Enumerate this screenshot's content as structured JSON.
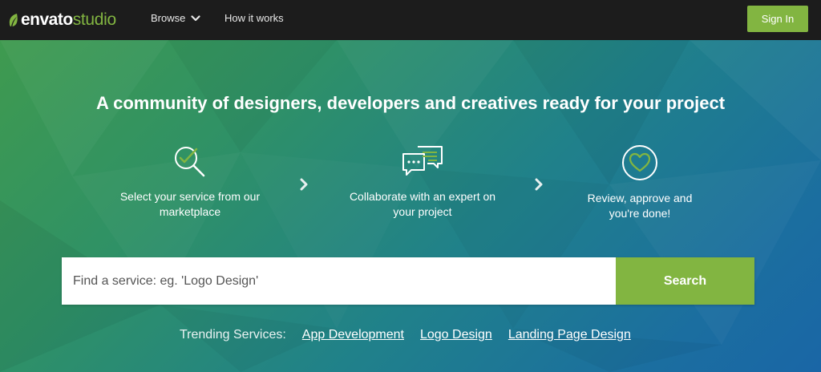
{
  "header": {
    "logo": {
      "word1": "envato",
      "word2": "studio",
      "icon": "leaf-icon"
    },
    "nav": [
      {
        "label": "Browse",
        "icon": "chevron-down-icon"
      },
      {
        "label": "How it works"
      }
    ],
    "sign_in_label": "Sign In"
  },
  "hero": {
    "headline": "A community of designers, developers and creatives ready for your project",
    "steps": [
      {
        "icon": "magnifier-check-icon",
        "label_line1": "Select your service from our",
        "label_line2": "marketplace"
      },
      {
        "icon": "chat-bubbles-icon",
        "label_line1": "Collaborate with an expert on",
        "label_line2": "your project"
      },
      {
        "icon": "heart-circle-icon",
        "label_line1": "Review, approve and",
        "label_line2": "you're done!"
      }
    ],
    "search": {
      "placeholder": "Find a service: eg. 'Logo Design'",
      "button_label": "Search"
    },
    "trending": {
      "label": "Trending Services:",
      "links": [
        "App Development",
        "Logo Design",
        "Landing Page Design"
      ]
    }
  },
  "colors": {
    "accent": "#82b541",
    "topbar": "#1c1c1c",
    "hero_start": "#3f9a4f",
    "hero_end": "#1a66a6"
  }
}
